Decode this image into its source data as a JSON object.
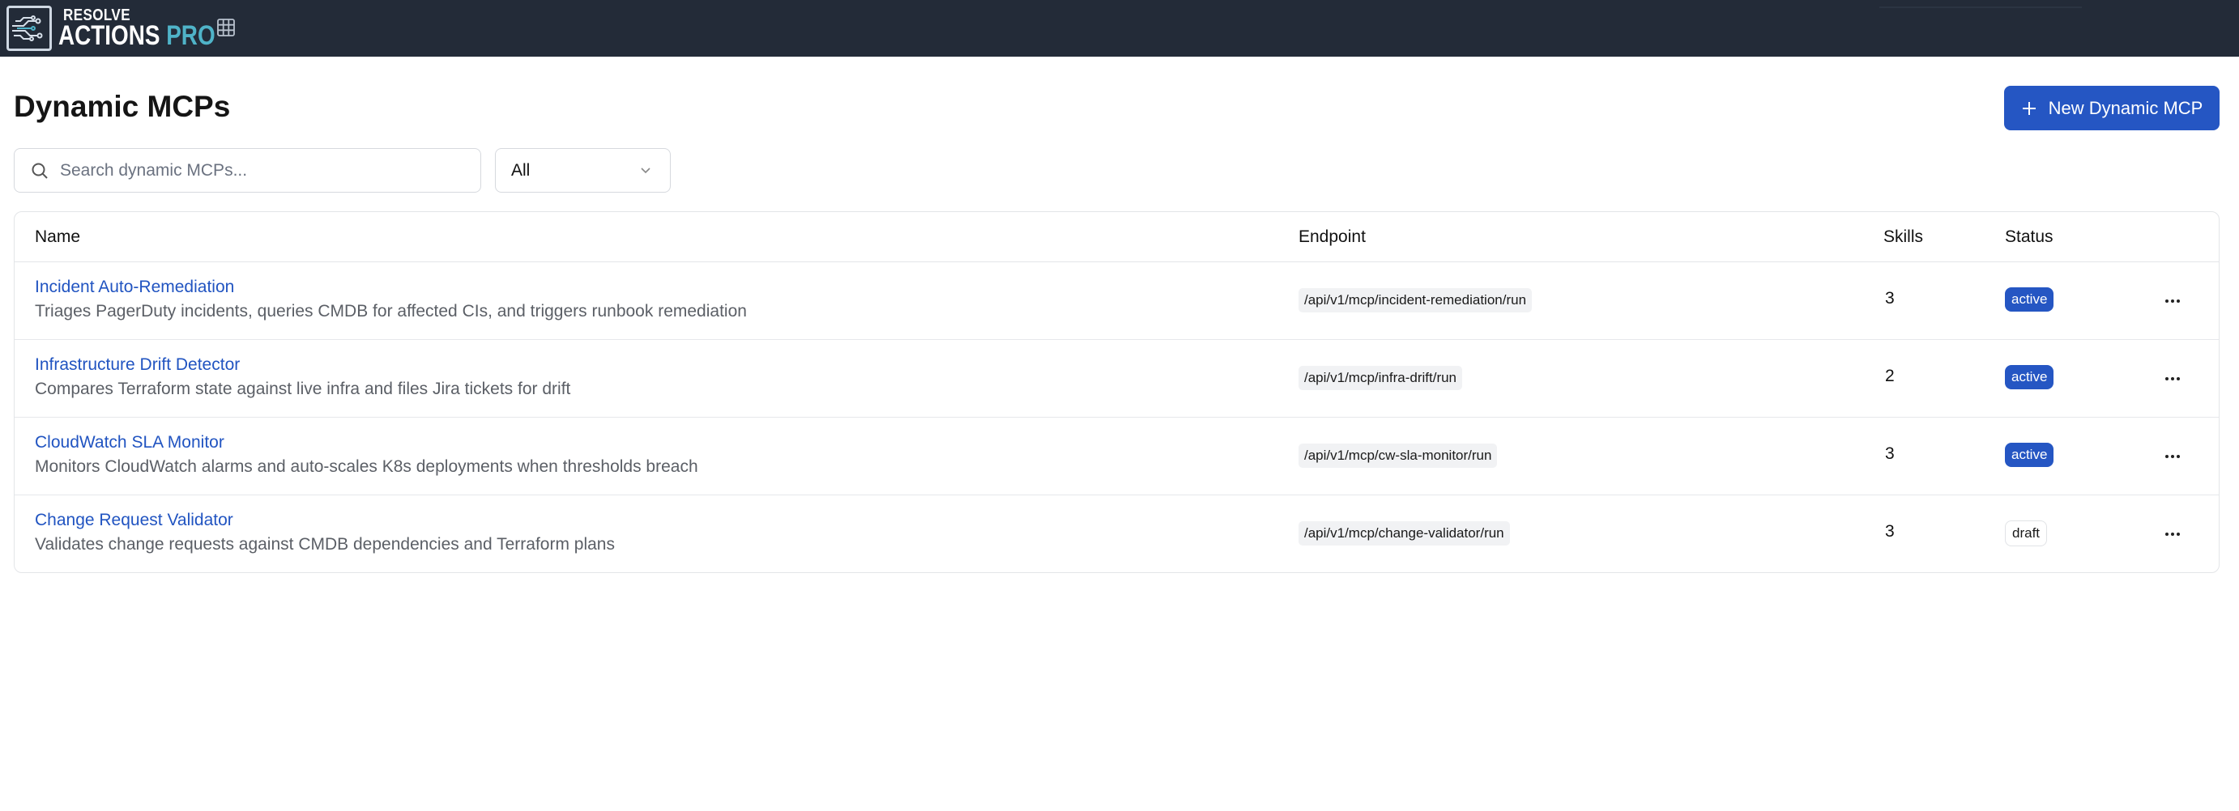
{
  "app": {
    "brand_top": "RESOLVE",
    "brand_main": "ACTIONS",
    "brand_pro": "PRO",
    "colors": {
      "topbar": "#232b38",
      "accent": "#2556c3",
      "brand_pro": "#4fb3c8",
      "link": "#2154c1"
    }
  },
  "header": {
    "title": "Dynamic MCPs",
    "new_button_label": "New Dynamic MCP"
  },
  "filters": {
    "search_placeholder": "Search dynamic MCPs...",
    "search_value": "",
    "status_selected": "All"
  },
  "table": {
    "columns": {
      "name": "Name",
      "endpoint": "Endpoint",
      "skills": "Skills",
      "status": "Status"
    },
    "rows": [
      {
        "name": "Incident Auto-Remediation",
        "description": "Triages PagerDuty incidents, queries CMDB for affected CIs, and triggers runbook remediation",
        "endpoint": "/api/v1/mcp/incident-remediation/run",
        "skills": "3",
        "status": "active"
      },
      {
        "name": "Infrastructure Drift Detector",
        "description": "Compares Terraform state against live infra and files Jira tickets for drift",
        "endpoint": "/api/v1/mcp/infra-drift/run",
        "skills": "2",
        "status": "active"
      },
      {
        "name": "CloudWatch SLA Monitor",
        "description": "Monitors CloudWatch alarms and auto-scales K8s deployments when thresholds breach",
        "endpoint": "/api/v1/mcp/cw-sla-monitor/run",
        "skills": "3",
        "status": "active"
      },
      {
        "name": "Change Request Validator",
        "description": "Validates change requests against CMDB dependencies and Terraform plans",
        "endpoint": "/api/v1/mcp/change-validator/run",
        "skills": "3",
        "status": "draft"
      }
    ]
  },
  "icons": {
    "logo": "circuit-logo-icon",
    "apps": "grid-icon",
    "search": "search-icon",
    "dropdown": "chevron-down-icon",
    "add": "plus-icon",
    "row_menu": "more-horizontal-icon"
  }
}
